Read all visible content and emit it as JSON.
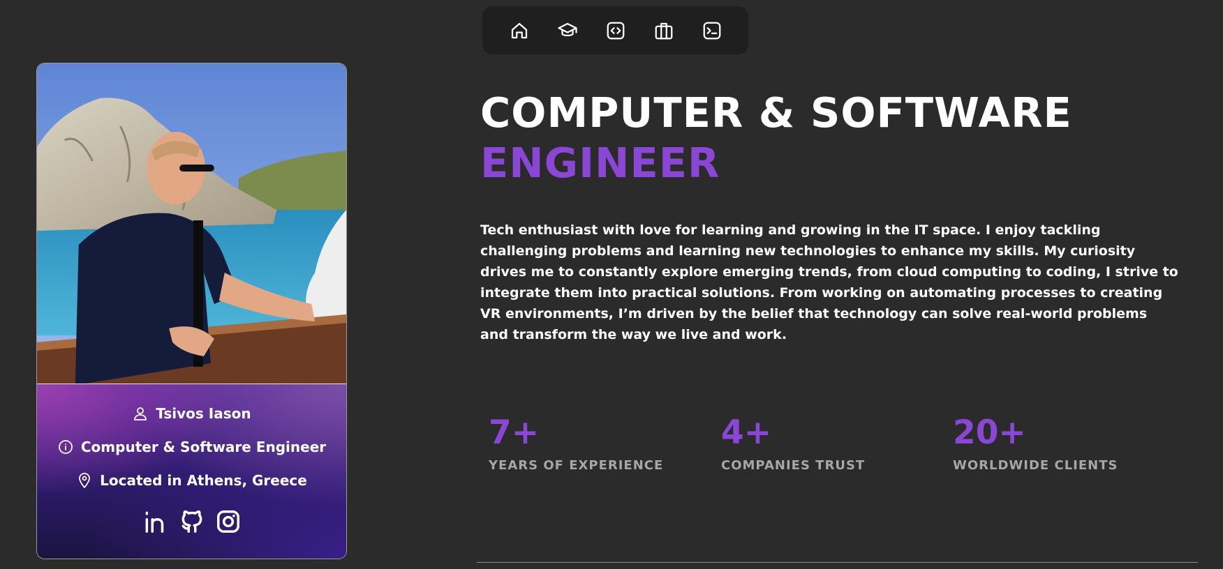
{
  "nav": {
    "items": [
      {
        "name": "home",
        "icon": "home-icon"
      },
      {
        "name": "education",
        "icon": "graduation-cap-icon"
      },
      {
        "name": "projects",
        "icon": "code-icon"
      },
      {
        "name": "experience",
        "icon": "briefcase-icon"
      },
      {
        "name": "terminal",
        "icon": "terminal-icon"
      }
    ]
  },
  "profile": {
    "name": "Tsivos Iason",
    "role": "Computer & Software Engineer",
    "location": "Located in Athens, Greece",
    "socials": [
      {
        "name": "linkedin",
        "icon": "linkedin-icon"
      },
      {
        "name": "github",
        "icon": "github-icon"
      },
      {
        "name": "instagram",
        "icon": "instagram-icon"
      }
    ]
  },
  "hero": {
    "title_line1": "COMPUTER & SOFTWARE",
    "title_line2": "ENGINEER",
    "bio": "Tech enthusiast with love for learning and growing in the IT space. I enjoy tackling challenging problems and learning new technologies to enhance my skills. My curiosity drives me to constantly explore emerging trends, from cloud computing to coding, I strive to integrate them into practical solutions. From working on automating processes to creating VR environments, I’m driven by the belief that technology can solve real-world problems and transform the way we live and work."
  },
  "stats": [
    {
      "value": "7+",
      "label": "YEARS OF EXPERIENCE"
    },
    {
      "value": "4+",
      "label": "COMPANIES TRUST"
    },
    {
      "value": "20+",
      "label": "WORLDWIDE CLIENTS"
    }
  ],
  "colors": {
    "background": "#2b2b2b",
    "accent": "#8a47d6",
    "nav_background": "#1f1f1f",
    "stat_label": "#a7a7a7"
  }
}
